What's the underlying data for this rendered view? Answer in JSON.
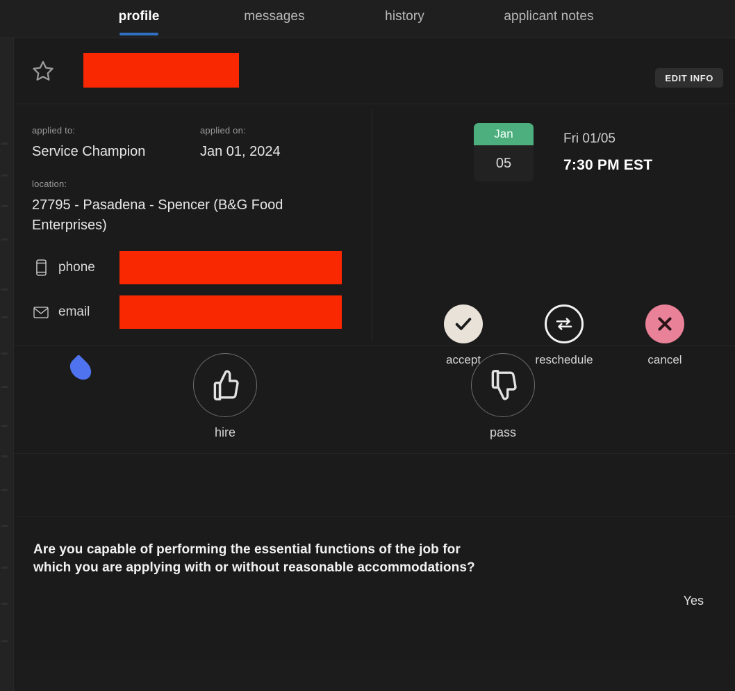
{
  "tabs": [
    {
      "label": "profile",
      "active": true
    },
    {
      "label": "messages",
      "active": false
    },
    {
      "label": "history",
      "active": false
    },
    {
      "label": "applicant notes",
      "active": false
    }
  ],
  "header": {
    "favorite_icon": "star-outline-icon",
    "candidate_name_redacted": "",
    "edit_info_label": "EDIT INFO"
  },
  "info": {
    "applied_to_label": "applied to:",
    "applied_to_value": "Service Champion",
    "applied_on_label": "applied on:",
    "applied_on_value": "Jan 01, 2024",
    "location_label": "location:",
    "location_value": "27795 - Pasadena - Spencer (B&G Food Enterprises)",
    "phone_label": "phone",
    "phone_value_redacted": "",
    "phone_icon": "mobile-phone-icon",
    "email_label": "email",
    "email_value_redacted": "",
    "email_icon": "envelope-icon"
  },
  "interview": {
    "month": "Jan",
    "day": "05",
    "day_of_week_date": "Fri 01/05",
    "time": "7:30 PM EST",
    "actions": [
      {
        "label": "accept",
        "icon": "checkmark-icon"
      },
      {
        "label": "reschedule",
        "icon": "swap-arrows-icon"
      },
      {
        "label": "cancel",
        "icon": "x-close-icon"
      }
    ]
  },
  "decision": {
    "hire_label": "hire",
    "hire_icon": "thumbs-up-icon",
    "pass_label": "pass",
    "pass_icon": "thumbs-down-icon",
    "cursor_icon": "teardrop-cursor-icon"
  },
  "question": {
    "text": "Are you capable of performing the essential functions of the job for which you are applying with or without reasonable accommodations?",
    "answer": "Yes"
  },
  "colors": {
    "accent_blue": "#2f6fc4",
    "month_green": "#4caf7d",
    "cancel_pink": "#e98198",
    "accept_cream": "#e8e2d8",
    "redaction_red": "#fa2800",
    "cursor_blue": "#4f72ef",
    "background": "#1c1c1c"
  }
}
